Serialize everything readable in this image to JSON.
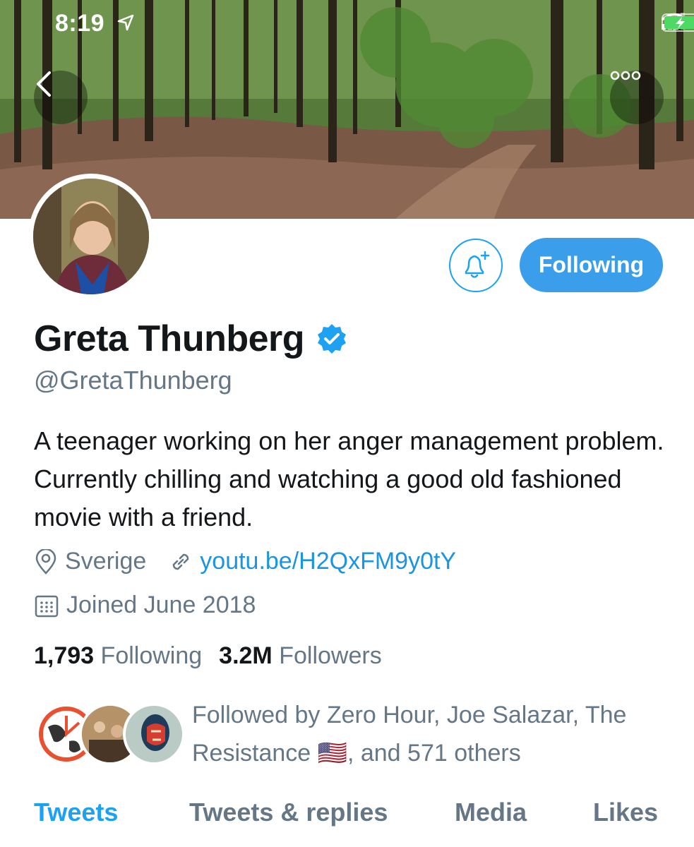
{
  "status_bar": {
    "time": "8:19",
    "icons": [
      "location-arrow-icon",
      "signal-icon",
      "wifi-icon",
      "battery-charging-icon"
    ]
  },
  "header": {
    "back_icon": "chevron-left-icon",
    "more_icon": "more-dots-icon"
  },
  "profile": {
    "name": "Greta Thunberg",
    "verified_icon": "verified-badge-icon",
    "handle": "@GretaThunberg",
    "bio": "A teenager working on her anger management problem. Currently chilling and watching a good old fashioned movie with a friend.",
    "location": "Sverige",
    "link": "youtu.be/H2QxFM9y0tY",
    "joined": "Joined June 2018",
    "following_count": "1,793",
    "following_label": "Following",
    "followers_count": "3.2M",
    "followers_label": "Followers"
  },
  "actions": {
    "notify_icon": "bell-plus-icon",
    "follow_button_label": "Following"
  },
  "followed_by": {
    "text": "Followed by Zero Hour, Joe Salazar, The Resistance 🇺🇸, and 571 others"
  },
  "tabs": [
    {
      "label": "Tweets",
      "active": true
    },
    {
      "label": "Tweets & replies",
      "active": false
    },
    {
      "label": "Media",
      "active": false
    },
    {
      "label": "Likes",
      "active": false
    }
  ],
  "colors": {
    "accent": "#1da1f2",
    "follow_button": "#3b9eeb",
    "secondary_text": "#657786",
    "link": "#1b95e0"
  }
}
